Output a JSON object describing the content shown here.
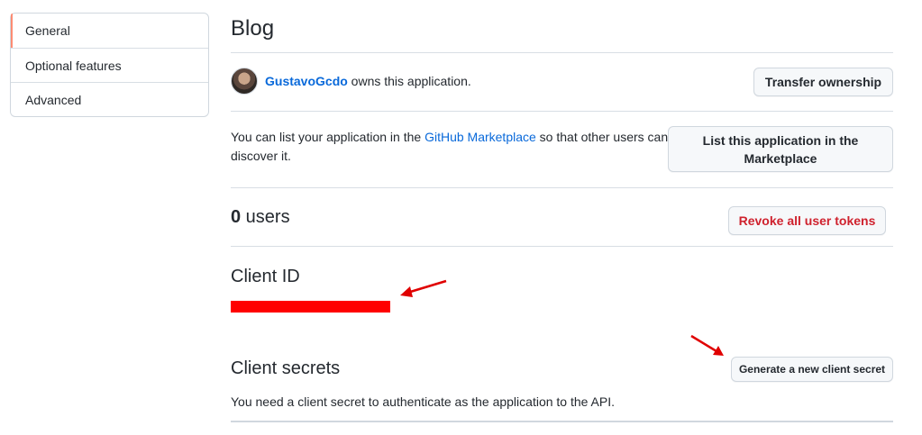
{
  "sidebar": {
    "items": [
      {
        "label": "General",
        "active": true
      },
      {
        "label": "Optional features",
        "active": false
      },
      {
        "label": "Advanced",
        "active": false
      }
    ]
  },
  "app": {
    "title": "Blog"
  },
  "owner": {
    "username": "GustavoGcdo",
    "suffix": " owns this application.",
    "transfer_label": "Transfer ownership"
  },
  "marketplace": {
    "text_before": "You can list your application in the ",
    "link": "GitHub Marketplace",
    "text_after": " so that other users can discover it.",
    "button_line1": "List this application in the",
    "button_line2": "Marketplace"
  },
  "users": {
    "count": "0",
    "label": " users",
    "revoke_label": "Revoke all user tokens"
  },
  "client_id": {
    "title": "Client ID"
  },
  "client_secrets": {
    "title": "Client secrets",
    "generate_label": "Generate a new client secret",
    "description": "You need a client secret to authenticate as the application to the API."
  },
  "colors": {
    "link": "#0969da",
    "danger": "#cf222e",
    "active_indicator": "#fd8c73",
    "annotation": "#ff0000"
  }
}
